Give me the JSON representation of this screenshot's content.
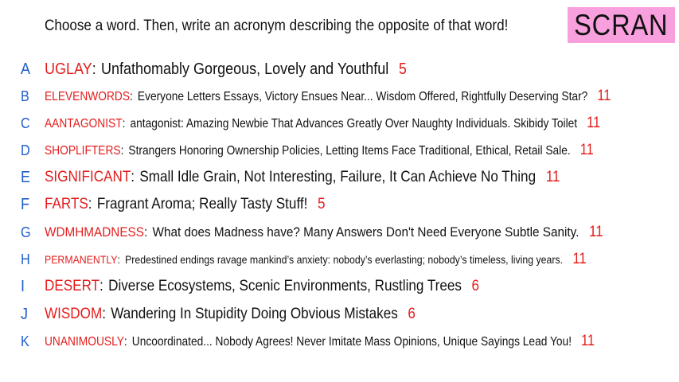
{
  "header": {
    "prompt": "Choose a word. Then, write an acronym describing the opposite of that word!",
    "badge": "SCRAN"
  },
  "colors": {
    "letter": "#1f5ec9",
    "word": "#e31d1d",
    "count": "#e31d1d",
    "badge_bg": "#f8a0dd"
  },
  "rows": [
    {
      "letter": "A",
      "word": "UGLAY",
      "acronym": "Unfathomably Gorgeous, Lovely and Youthful",
      "count": "5"
    },
    {
      "letter": "B",
      "word": "ELEVENWORDS",
      "acronym": "Everyone Letters Essays, Victory Ensues Near... Wisdom Offered, Rightfully Deserving Star?",
      "count": "11"
    },
    {
      "letter": "C",
      "word": "AANTAGONIST",
      "acronym": "antagonist: Amazing Newbie That Advances Greatly Over Naughty Individuals. Skibidy Toilet",
      "count": "11"
    },
    {
      "letter": "D",
      "word": "SHOPLIFTERS",
      "acronym": "Strangers Honoring Ownership Policies, Letting Items Face Traditional, Ethical, Retail Sale.",
      "count": "11"
    },
    {
      "letter": "E",
      "word": "SIGNIFICANT",
      "acronym": "Small Idle Grain, Not Interesting, Failure, It Can Achieve No Thing",
      "count": "11"
    },
    {
      "letter": "F",
      "word": "FARTS",
      "acronym": "Fragrant Aroma; Really Tasty Stuff!",
      "count": "5"
    },
    {
      "letter": "G",
      "word": "WDMHMADNESS",
      "acronym": "What does Madness have? Many Answers Don't Need Everyone Subtle Sanity.",
      "count": "11"
    },
    {
      "letter": "H",
      "word": "PERMANENTLY",
      "acronym": "Predestined endings ravage mankind’s anxiety: nobody’s everlasting; nobody’s timeless, living years.",
      "count": "11"
    },
    {
      "letter": "I",
      "word": "DESERT",
      "acronym": "Diverse Ecosystems, Scenic Environments, Rustling Trees",
      "count": "6"
    },
    {
      "letter": "J",
      "word": "WISDOM",
      "acronym": "Wandering In Stupidity Doing Obvious Mistakes",
      "count": "6"
    },
    {
      "letter": "K",
      "word": "UNANIMOUSLY",
      "acronym": "Uncoordinated... Nobody Agrees! Never Imitate Mass Opinions, Unique Sayings Lead You!",
      "count": "11"
    }
  ]
}
